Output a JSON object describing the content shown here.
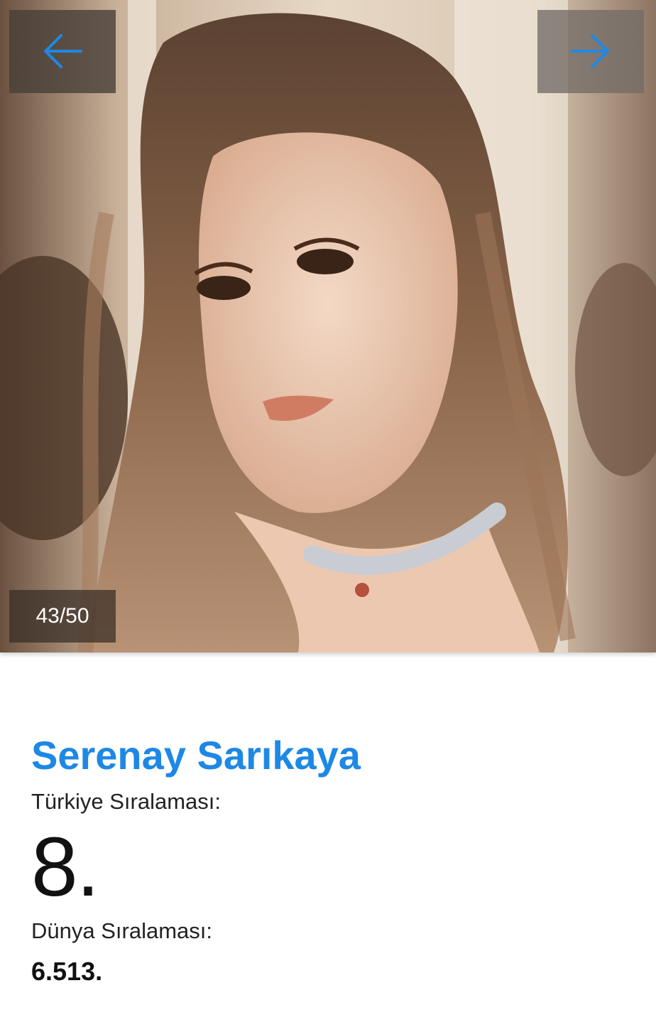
{
  "gallery": {
    "photo_alt": "Serenay Sarıkaya",
    "counter": "43/50",
    "prev_icon": "arrow-left-icon",
    "next_icon": "arrow-right-icon",
    "accent_color": "#1e88e5"
  },
  "profile": {
    "name": "Serenay Sarıkaya",
    "turkey_rank_label": "Türkiye Sıralaması:",
    "turkey_rank": "8.",
    "world_rank_label": "Dünya Sıralaması:",
    "world_rank": "6.513."
  }
}
